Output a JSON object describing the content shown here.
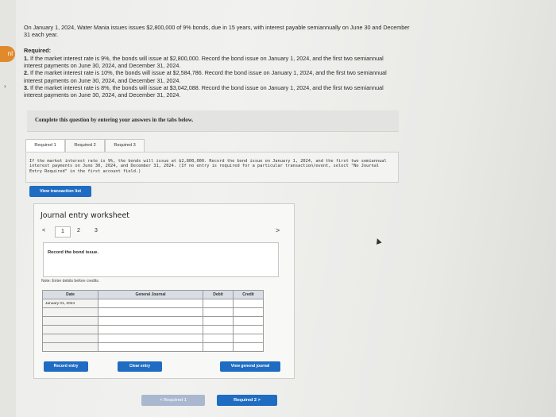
{
  "side": {
    "badge": "nl",
    "arrow": "›"
  },
  "intro": "On January 1, 2024, Water Mania issues issues $2,800,000 of 9% bonds, due in 15 years, with interest payable semiannually on June 30 and December 31 each year.",
  "required": {
    "title": "Required:",
    "items": [
      {
        "num": "1.",
        "text": "If the market interest rate is 9%, the bonds will issue at $2,800,000. Record the bond issue on January 1, 2024, and the first two semiannual interest payments on June 30, 2024, and December 31, 2024."
      },
      {
        "num": "2.",
        "text": "If the market interest rate is 10%, the bonds will issue at $2,584,786. Record the bond issue on January 1, 2024, and the first two semiannual interest payments on June 30, 2024, and December 31, 2024."
      },
      {
        "num": "3.",
        "text": "If the market interest rate is 8%, the bonds will issue at $3,042,088. Record the bond issue on January 1, 2024, and the first two semiannual interest payments on June 30, 2024, and December 31, 2024."
      }
    ]
  },
  "instruction": "Complete this question by entering your answers in the tabs below.",
  "tabs": [
    "Required 1",
    "Required 2",
    "Required 3"
  ],
  "tab_panel": "If the market interest rate is 9%, the bonds will issue at $2,800,000. Record the bond issue on January 1, 2024, and the first two semiannual interest payments on June 30, 2024, and December 31, 2024. (If no entry is required for a particular transaction/event, select \"No Journal Entry Required\" in the first account field.)",
  "view_transaction_list": "View transaction list",
  "worksheet": {
    "title": "Journal entry worksheet",
    "prev": "<",
    "next": ">",
    "pages": [
      "1",
      "2",
      "3"
    ],
    "task": "Record the bond issue.",
    "note": "Note: Enter debits before credits.",
    "columns": [
      "Date",
      "General Journal",
      "Debit",
      "Credit"
    ],
    "rows": [
      {
        "date": "January 01, 2024"
      },
      {
        "date": ""
      },
      {
        "date": ""
      },
      {
        "date": ""
      },
      {
        "date": ""
      },
      {
        "date": ""
      }
    ],
    "record_entry": "Record entry",
    "clear_entry": "Clear entry",
    "view_general_journal": "View general journal"
  },
  "nav": {
    "prev": "< Required 1",
    "next": "Required 2 >"
  },
  "colors": {
    "accent_blue": "#1f6cc3",
    "green": "#2f8f45"
  }
}
